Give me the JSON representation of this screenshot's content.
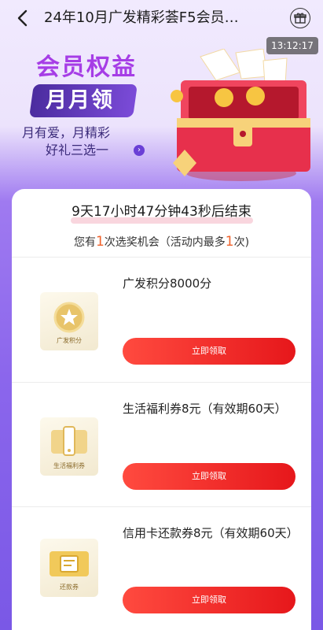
{
  "header": {
    "title": "24年10月广发精彩荟F5会员…",
    "time": "13:12:17"
  },
  "banner": {
    "title": "会员权益",
    "subtitle": "月月领",
    "desc_line1": "月有爱，月精彩",
    "desc_line2": "好礼三选一"
  },
  "card": {
    "countdown": "9天17小时47分钟43秒后结束",
    "chance_prefix": "您有",
    "chance_count": "1",
    "chance_mid": "次选奖机会（活动内最多",
    "chance_max": "1",
    "chance_suffix": "次)"
  },
  "prizes": [
    {
      "name": "广发积分8000分",
      "img_label": "广发积分",
      "button": "立即领取",
      "icon": "star-coin-icon"
    },
    {
      "name": "生活福利券8元（有效期60天）",
      "img_label": "生活福利券",
      "button": "立即领取",
      "icon": "phone-voucher-icon"
    },
    {
      "name": "信用卡还款券8元（有效期60天）",
      "img_label": "还款券",
      "button": "立即领取",
      "icon": "repayment-voucher-icon"
    }
  ],
  "colors": {
    "accent_purple": "#a63de6",
    "button_red": "#e6171b",
    "highlight_orange": "#f0622b"
  }
}
